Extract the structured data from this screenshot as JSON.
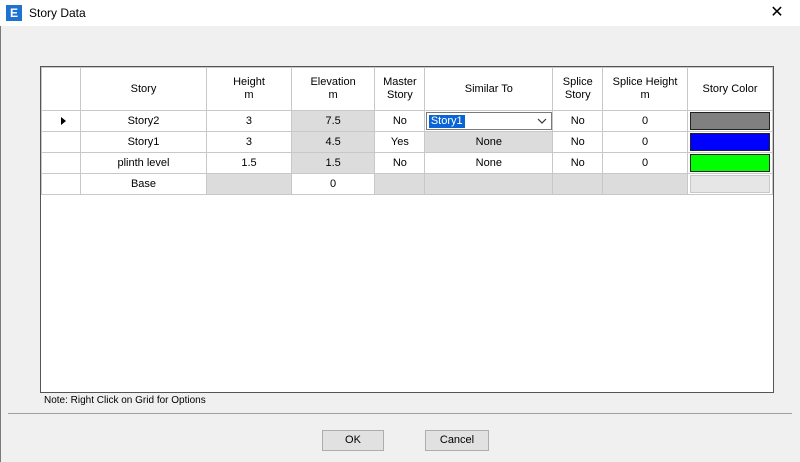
{
  "window": {
    "title": "Story Data",
    "icon_letter": "E",
    "close_symbol": "✕"
  },
  "grid": {
    "headers": {
      "story": "Story",
      "height": "Height",
      "height_unit": "m",
      "elevation": "Elevation",
      "elevation_unit": "m",
      "master_story_1": "Master",
      "master_story_2": "Story",
      "similar_to": "Similar To",
      "splice_story_1": "Splice",
      "splice_story_2": "Story",
      "splice_height": "Splice Height",
      "splice_height_unit": "m",
      "story_color": "Story Color"
    },
    "rows": [
      {
        "story": "Story2",
        "height": "3",
        "elevation": "7.5",
        "master": "No",
        "similar_to": "Story1",
        "splice_story": "No",
        "splice_height": "0",
        "color": "#808080"
      },
      {
        "story": "Story1",
        "height": "3",
        "elevation": "4.5",
        "master": "Yes",
        "similar_to": "None",
        "splice_story": "No",
        "splice_height": "0",
        "color": "#0000ff"
      },
      {
        "story": "plinth level",
        "height": "1.5",
        "elevation": "1.5",
        "master": "No",
        "similar_to": "None",
        "splice_story": "No",
        "splice_height": "0",
        "color": "#00ff00"
      },
      {
        "story": "Base",
        "height": "",
        "elevation": "0",
        "master": "",
        "similar_to": "",
        "splice_story": "",
        "splice_height": "",
        "color": ""
      }
    ]
  },
  "note": "Note:  Right Click on Grid for Options",
  "buttons": {
    "ok": "OK",
    "cancel": "Cancel"
  }
}
